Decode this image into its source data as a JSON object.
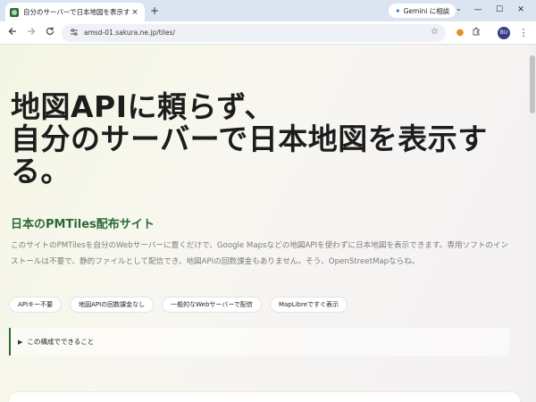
{
  "browser": {
    "tab_title": "自分のサーバーで日本地図を表示する",
    "tab_close": "×",
    "new_tab": "+",
    "gemini_icon": "✦",
    "gemini_label": "Gemini に相談",
    "tab_dropdown": "⌄",
    "win_minimize": "—",
    "win_maximize": "☐",
    "win_close": "✕",
    "url": "amsd-01.sakura.ne.jp/tiles/",
    "profile_initials": "BU",
    "icons": {
      "back": "arrow-left-icon",
      "forward": "arrow-right-icon",
      "reload": "reload-icon",
      "site_info": "tune-icon",
      "bookmark": "star-icon",
      "extension_1": "orange-extension-icon",
      "extension_2": "puzzle-icon",
      "menu": "more-vert-icon"
    }
  },
  "page": {
    "title_lines": [
      "地図APIに頼らず、",
      "自分のサーバーで日本地図を表示す",
      "る。"
    ],
    "subtitle": "日本のPMTiles配布サイト",
    "description": "このサイトのPMTilesを自分のWebサーバーに置くだけで、Google Mapsなどの地図APIを使わずに日本地図を表示できます。専用ソフトのインストールは不要で、静的ファイルとして配信でき、地図APIの回数課金もありません。そう、OpenStreetMapならね。",
    "tags": [
      "APIキー不要",
      "地図APIの回数課金なし",
      "一般的なWebサーバーで配信",
      "MapLibreですぐ表示"
    ],
    "details_label": "この構成でできること",
    "colors": {
      "accent_green": "#2a6a37",
      "title_text": "#1d1d1d",
      "body_text": "#7a7a7a"
    }
  }
}
